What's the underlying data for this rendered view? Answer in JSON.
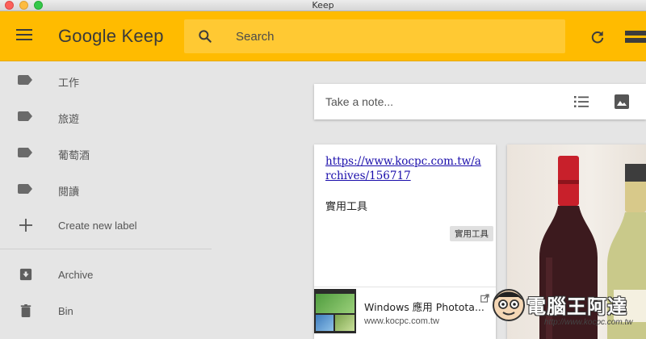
{
  "window": {
    "title": "Keep"
  },
  "header": {
    "brand": "Google Keep",
    "search_placeholder": "Search",
    "accent_color": "#ffbb00"
  },
  "sidebar": {
    "items": [
      {
        "label": "工作",
        "icon": "label-icon"
      },
      {
        "label": "旅遊",
        "icon": "label-icon"
      },
      {
        "label": "葡萄酒",
        "icon": "label-icon"
      },
      {
        "label": "閱讀",
        "icon": "label-icon"
      },
      {
        "label": "Create new label",
        "icon": "plus-icon"
      },
      {
        "label": "Archive",
        "icon": "archive-icon"
      },
      {
        "label": "Bin",
        "icon": "trash-icon"
      }
    ]
  },
  "composer": {
    "placeholder": "Take a note..."
  },
  "notes": [
    {
      "link": "https://www.kocpc.com.tw/archives/156717",
      "text": "實用工具",
      "label_chip": "實用工具",
      "preview": {
        "title": "Windows 應用 Phototа...",
        "domain": "www.kocpc.com.tw"
      }
    }
  ],
  "watermark": {
    "text": "電腦王阿達",
    "url": "http://www.kocpc.com.tw"
  }
}
